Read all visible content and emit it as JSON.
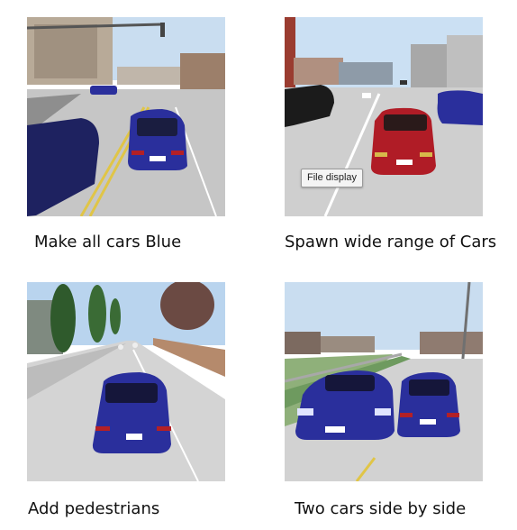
{
  "cards": [
    {
      "caption": "Make all cars Blue"
    },
    {
      "caption": "Spawn wide range of Cars"
    },
    {
      "caption": "Add pedestrians"
    },
    {
      "caption": "Two cars side by side"
    }
  ],
  "tooltip": {
    "text": "File display"
  },
  "plates": {
    "front": "CARLA"
  },
  "colors": {
    "sky": "#c9ddf0",
    "road": "#c7c7c7",
    "blue_car": "#2a2f9c",
    "red_car": "#b01c26"
  }
}
